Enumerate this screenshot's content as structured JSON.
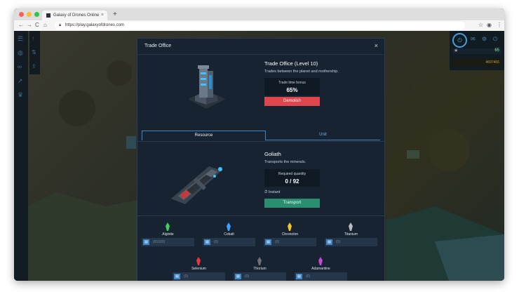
{
  "browser": {
    "tab_title": "Galaxy of Drones Online",
    "tab_close": "×",
    "new_tab": "+",
    "url": "https://play.galaxyofdrones.com",
    "nav_back": "←",
    "nav_forward": "→",
    "nav_reload": "C",
    "nav_home": "⌂",
    "star": "☆",
    "account": "◉",
    "menu": "⋮"
  },
  "hud": {
    "level_value": "65",
    "gold_value": "4697406",
    "star_glyph": "★"
  },
  "modal": {
    "title": "Trade Office",
    "close": "×",
    "building_name": "Trade Office (Level 10)",
    "building_desc": "Trades between the planet and mothership.",
    "bonus_label": "Trade time bonus",
    "bonus_value": "65%",
    "demolish_label": "Demolish",
    "tabs": [
      {
        "label": "Resource"
      },
      {
        "label": "Unit"
      }
    ],
    "unit_name": "Goliath",
    "unit_desc": "Transports the minerals.",
    "required_label": "Required quantity",
    "required_value": "0 / 92",
    "instant_label": "Instant",
    "instant_icon": "⏱",
    "transport_label": "Transport",
    "resources": [
      {
        "name": "Alginite",
        "placeholder": "(81000)",
        "color": "#3ecf5a"
      },
      {
        "name": "Cobalt",
        "placeholder": "(0)",
        "color": "#3fa0ff"
      },
      {
        "name": "Chronoton",
        "placeholder": "(0)",
        "color": "#f2c42c"
      },
      {
        "name": "Titanium",
        "placeholder": "(0)",
        "color": "#b7bcc2"
      },
      {
        "name": "Selenium",
        "placeholder": "(0)",
        "color": "#e8343c"
      },
      {
        "name": "Thorium",
        "placeholder": "(0)",
        "color": "#6f6f73"
      },
      {
        "name": "Adamantine",
        "placeholder": "(0)",
        "color": "#c24ad6"
      }
    ]
  },
  "colors": {
    "accent": "#3f86c6",
    "danger": "#e0444c",
    "success": "#2a8f6e",
    "panel": "#182331"
  }
}
